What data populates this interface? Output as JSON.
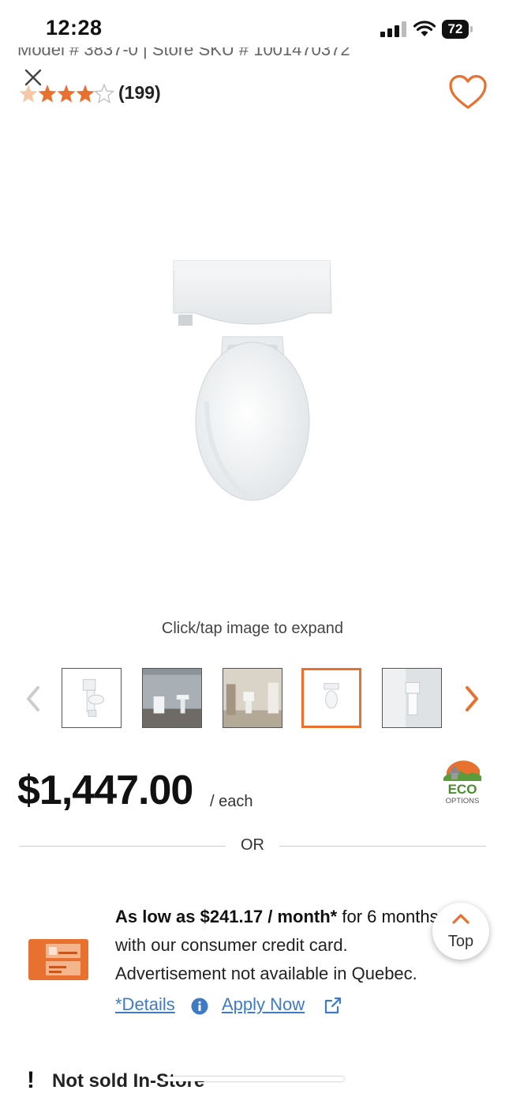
{
  "status_bar": {
    "time": "12:28",
    "battery": "72"
  },
  "product": {
    "model_line": "Model # 3837-0  |  Store SKU # 1001470372",
    "reviews": {
      "rating": 3.5,
      "count": "(199)"
    },
    "image_hint": "Click/tap image to expand",
    "thumbnail_count": 5,
    "selected_thumbnail": 4
  },
  "price": {
    "amount": "$1,447.00",
    "unit": "/ each",
    "eco_badge": {
      "line1": "ECO",
      "line2": "OPTIONS"
    }
  },
  "divider": {
    "or": "OR"
  },
  "promo": {
    "bold": "As low as $241.17 / month*",
    "rest": " for 6 months",
    "line2": "with our consumer credit card.",
    "line3": "Advertisement not available in Quebec.",
    "details_link": "*Details",
    "apply_link": "Apply Now"
  },
  "back_to_top": {
    "label": "Top"
  },
  "availability": {
    "text": "Not sold In-Store",
    "icon": "!"
  },
  "colors": {
    "accent": "#e8712f",
    "link": "#3e7bc4"
  }
}
